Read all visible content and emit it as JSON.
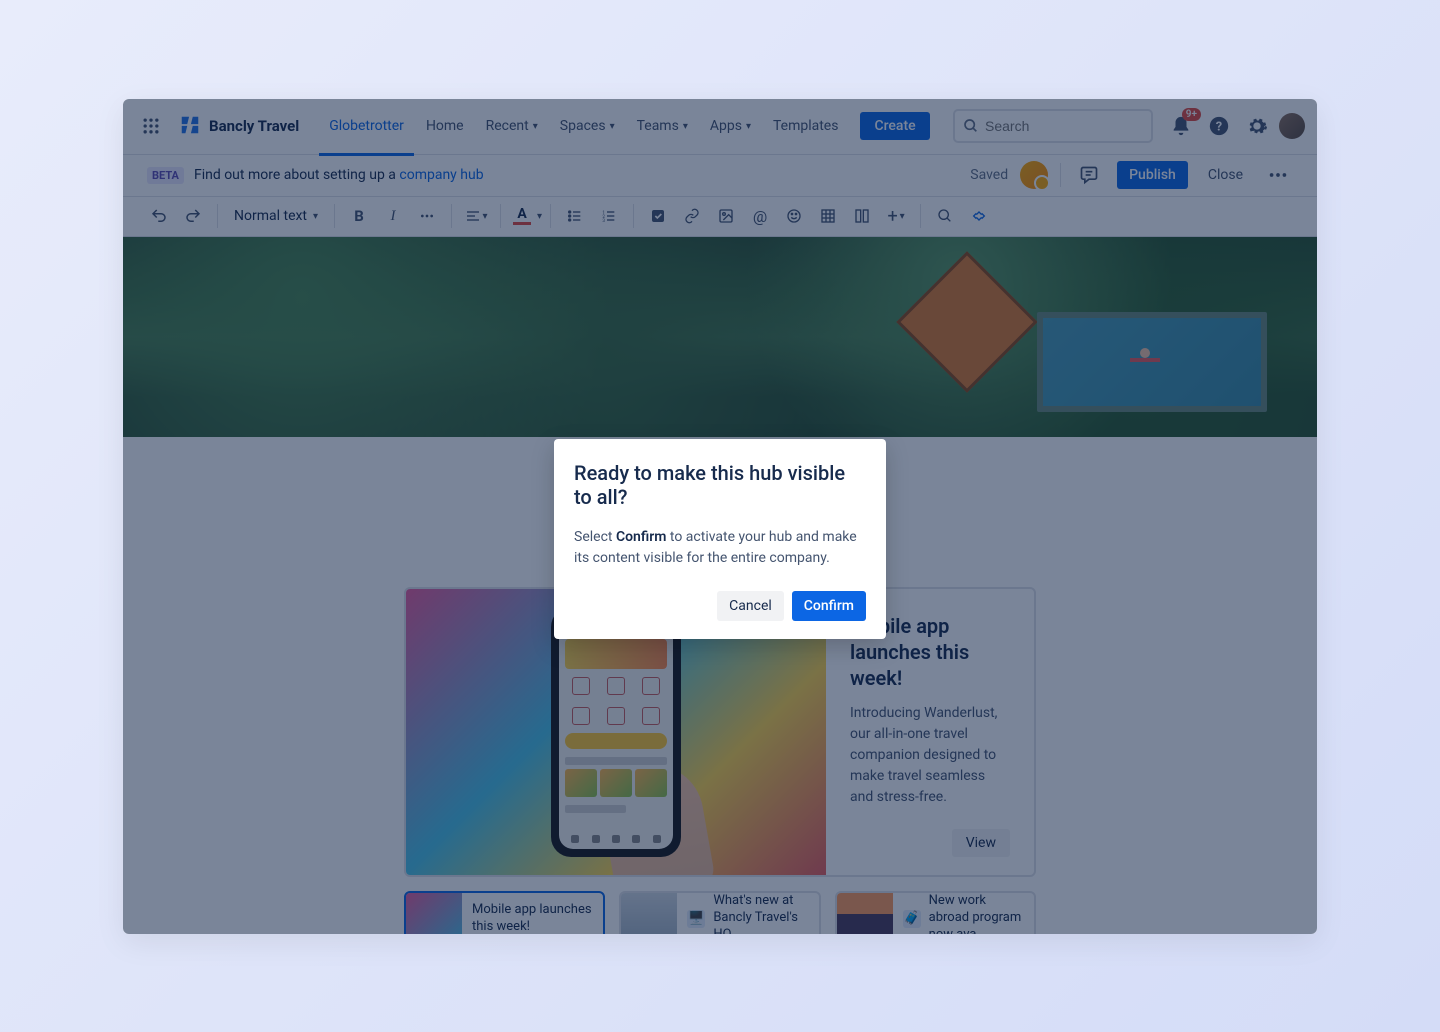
{
  "brand": {
    "name": "Bancly Travel"
  },
  "nav": {
    "items": [
      {
        "label": "Globetrotter",
        "active": true,
        "dropdown": false
      },
      {
        "label": "Home",
        "dropdown": false
      },
      {
        "label": "Recent",
        "dropdown": true
      },
      {
        "label": "Spaces",
        "dropdown": true
      },
      {
        "label": "Teams",
        "dropdown": true
      },
      {
        "label": "Apps",
        "dropdown": true
      },
      {
        "label": "Templates",
        "dropdown": false
      }
    ],
    "create": "Create",
    "search_placeholder": "Search",
    "notifications_badge": "9+"
  },
  "banner": {
    "beta": "BETA",
    "text_pre": "Find out more about setting up a ",
    "link": "company hub",
    "saved": "Saved",
    "publish": "Publish",
    "close": "Close"
  },
  "toolbar": {
    "text_style": "Normal text"
  },
  "feature_card": {
    "title": "Mobile app launches this week!",
    "desc": "Introducing Wanderlust, our all-in-one travel companion designed to make travel seamless and stress-free.",
    "view": "View"
  },
  "small_cards": [
    {
      "label": "Mobile app launches this week!",
      "icon_color": "#ffd54a"
    },
    {
      "label": "What's new at Bancly Travel's HQ",
      "icon_color": "#4ac5e8"
    },
    {
      "label": "New work abroad program now ava…",
      "icon_color": "#4ac5e8"
    }
  ],
  "modal": {
    "title": "Ready to make this hub visible to all?",
    "body_pre": "Select ",
    "body_bold": "Confirm",
    "body_post": " to activate your hub and make its content visible for the entire company.",
    "cancel": "Cancel",
    "confirm": "Confirm"
  }
}
